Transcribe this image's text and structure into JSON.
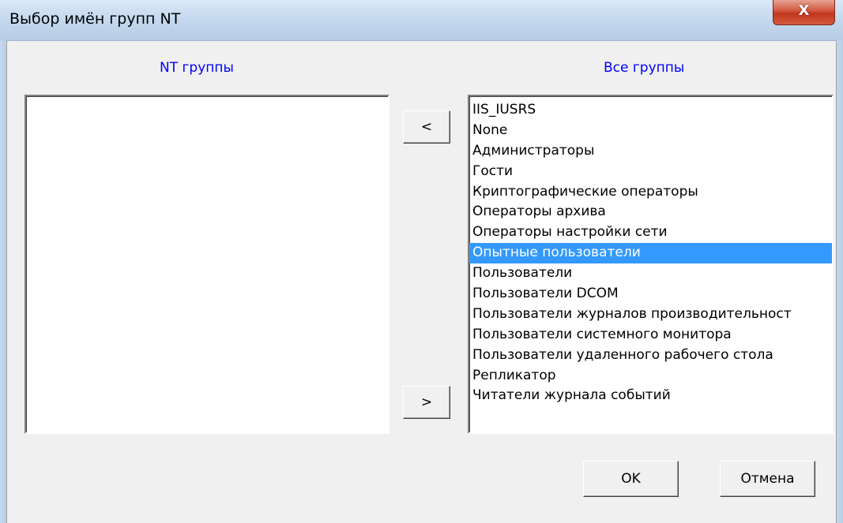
{
  "window": {
    "title": "Выбор имён групп NT",
    "close_label": "X"
  },
  "left_panel": {
    "caption": "NT группы",
    "items": []
  },
  "right_panel": {
    "caption": "Все группы",
    "items": [
      "IIS_IUSRS",
      "None",
      "Администраторы",
      "Гости",
      "Криптографические операторы",
      "Операторы архива",
      "Операторы настройки сети",
      "Опытные пользователи",
      "Пользователи",
      "Пользователи DCOM",
      "Пользователи журналов производительност",
      "Пользователи системного монитора",
      "Пользователи удаленного рабочего стола",
      "Репликатор",
      "Читатели журнала событий"
    ],
    "selected_index": 7
  },
  "buttons": {
    "move_left": "<",
    "move_right": ">",
    "ok": "OK",
    "cancel": "Отмена"
  }
}
